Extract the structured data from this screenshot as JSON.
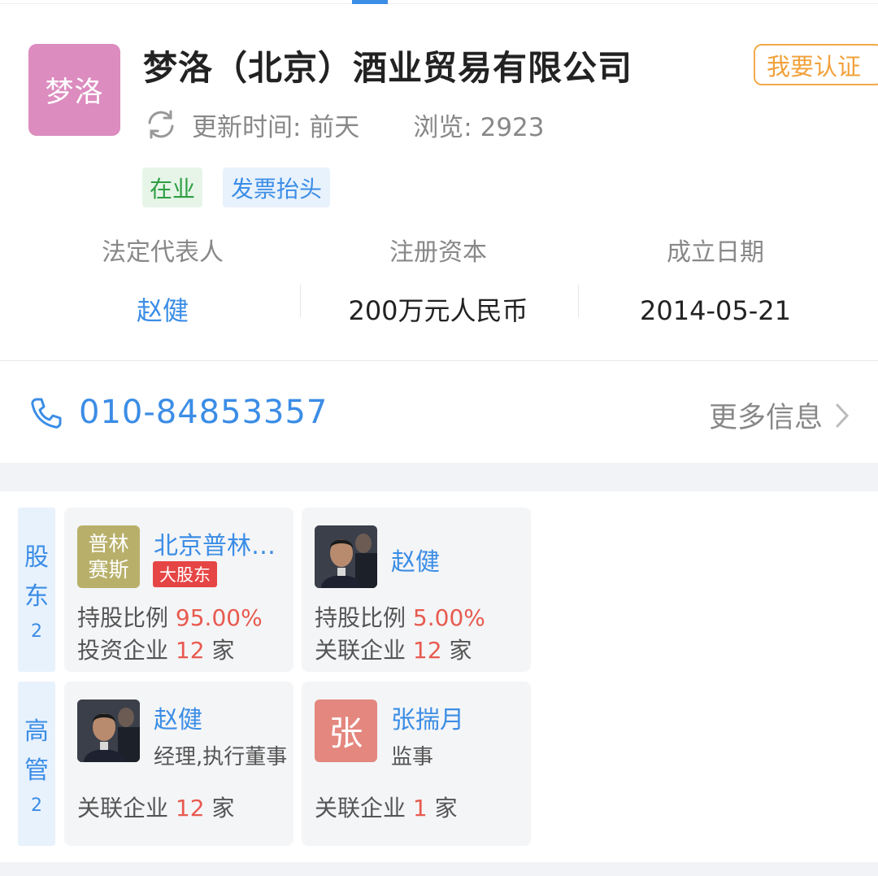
{
  "company": {
    "logo_text": "梦洛",
    "name": "梦洛（北京）酒业贸易有限公司",
    "certify_label": "我要认证",
    "updated": "更新时间: 前天",
    "views": "浏览: 2923",
    "tags": {
      "status": "在业",
      "invoice": "发票抬头"
    }
  },
  "info": {
    "legal_rep_label": "法定代表人",
    "legal_rep_value": "赵健",
    "capital_label": "注册资本",
    "capital_value": "200万元人民币",
    "founded_label": "成立日期",
    "founded_value": "2014-05-21"
  },
  "contact": {
    "phone": "010-84853357",
    "more_label": "更多信息"
  },
  "shareholders": {
    "label_chars": [
      "股",
      "东"
    ],
    "count": "2",
    "items": [
      {
        "avatar_lines": [
          "普林",
          "赛斯"
        ],
        "name": "北京普林…",
        "badge": "大股东",
        "ratio_label": "持股比例",
        "ratio_value": "95.00%",
        "rel_label": "投资企业",
        "rel_count": "12",
        "rel_unit": "家"
      },
      {
        "name": "赵健",
        "ratio_label": "持股比例",
        "ratio_value": "5.00%",
        "rel_label": "关联企业",
        "rel_count": "12",
        "rel_unit": "家"
      }
    ]
  },
  "executives": {
    "label_chars": [
      "高",
      "管"
    ],
    "count": "2",
    "items": [
      {
        "name": "赵健",
        "role": "经理,执行董事",
        "rel_label": "关联企业",
        "rel_count": "12",
        "rel_unit": "家"
      },
      {
        "avatar_text": "张",
        "name": "张揣月",
        "role": "监事",
        "rel_label": "关联企业",
        "rel_count": "1",
        "rel_unit": "家"
      }
    ]
  },
  "colors": {
    "accent_blue": "#3b8de6",
    "warning_orange": "#f2aa4b",
    "highlight_red": "#e85a4f",
    "logo_pink": "#dc8cbf"
  }
}
